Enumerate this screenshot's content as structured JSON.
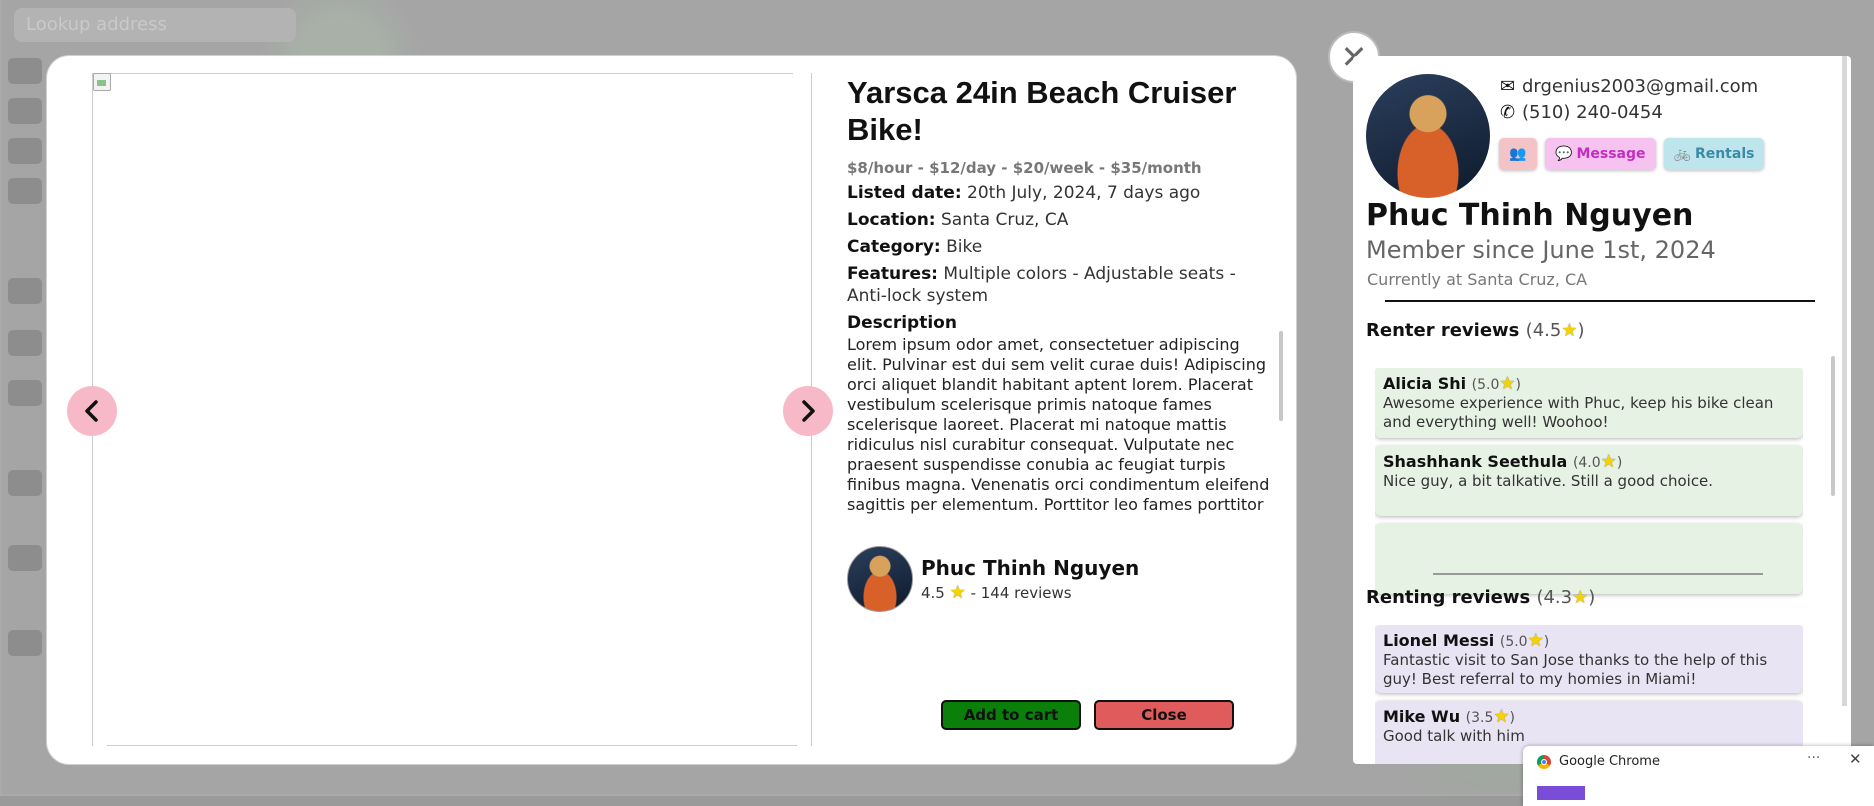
{
  "background": {
    "search_text": "Lookup address"
  },
  "product": {
    "title": "Yarsca 24in Beach Cruiser Bike!",
    "price": "$8/hour - $12/day - $20/week - $35/month",
    "listed_label": "Listed date:",
    "listed_value": "20th July, 2024, 7 days ago",
    "location_label": "Location:",
    "location_value": "Santa Cruz, CA",
    "category_label": "Category:",
    "category_value": "Bike",
    "features_label": "Features:",
    "features_value": "Multiple colors - Adjustable seats - Anti-lock system",
    "description_heading": "Description",
    "description": "Lorem ipsum odor amet, consectetuer adipiscing elit. Pulvinar est dui sem velit curae duis! Adipiscing orci aliquet blandit habitant aptent lorem. Placerat vestibulum scelerisque primis natoque fames scelerisque laoreet. Placerat mi natoque mattis ridiculus nisl curabitur consequat. Vulputate nec praesent suspendisse conubia ac feugiat turpis finibus magna. Venenatis orci condimentum eleifend sagittis per elementum. Porttitor leo fames porttitor habitasse mi nisi.",
    "prev_icon": "chevron-left-icon",
    "next_icon": "chevron-right-icon",
    "owner_name": "Phuc Thinh Nguyen",
    "owner_rating": "4.5",
    "owner_reviews": "- 144 reviews",
    "add_to_cart_label": "Add to cart",
    "close_label": "Close"
  },
  "close_x": "✕",
  "profile": {
    "email": "drgenius2003@gmail.com",
    "phone": "(510) 240-0454",
    "message_label": "Message",
    "rentals_label": "Rentals",
    "name": "Phuc Thinh Nguyen",
    "member_since": "Member since June 1st, 2024",
    "currently_at": "Currently at Santa Cruz, CA",
    "renter_reviews_title": "Renter reviews",
    "renter_reviews_rating": "(4.5",
    "renter_reviews": [
      {
        "name": "Alicia Shi",
        "rating": "(5.0",
        "text": "Awesome experience with Phuc, keep his bike clean and everything well! Woohoo!"
      },
      {
        "name": "Shashhank Seethula",
        "rating": "(4.0",
        "text": "Nice guy, a bit talkative. Still a good choice."
      },
      {
        "name": "",
        "rating": "",
        "text": ""
      }
    ],
    "renting_reviews_title": "Renting reviews",
    "renting_reviews_rating": "(4.3",
    "renting_reviews": [
      {
        "name": "Lionel Messi",
        "rating": "(5.0",
        "text": "Fantastic visit to San Jose thanks to the help of this guy! Best referral to my homies in Miami!"
      },
      {
        "name": "Mike Wu",
        "rating": "(3.5",
        "text": "Good talk with him"
      }
    ]
  },
  "toast": {
    "app_name": "Google Chrome",
    "more": "···",
    "close": "✕"
  }
}
